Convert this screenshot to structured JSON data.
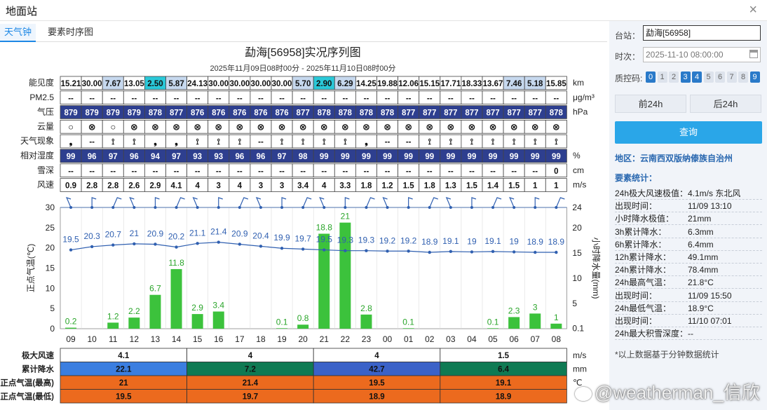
{
  "window": {
    "title": "地面站"
  },
  "tabs": [
    "天气钟",
    "要素时序图"
  ],
  "chart_data": {
    "type": "meteogram",
    "title": "勐海[56958]实况序列图",
    "subtitle": "2025年11月09日08时00分 - 2025年11月10日08时00分",
    "hours": [
      "09",
      "10",
      "11",
      "12",
      "13",
      "14",
      "15",
      "16",
      "17",
      "18",
      "19",
      "20",
      "21",
      "22",
      "23",
      "00",
      "01",
      "02",
      "03",
      "04",
      "05",
      "06",
      "07",
      "08"
    ],
    "rows": [
      {
        "label": "能见度",
        "unit": "km",
        "values": [
          "15.21",
          "30.00",
          "7.67",
          "13.05",
          "2.50",
          "5.87",
          "24.13",
          "30.00",
          "30.00",
          "30.00",
          "30.00",
          "5.70",
          "2.90",
          "6.29",
          "14.25",
          "19.88",
          "12.06",
          "15.15",
          "17.71",
          "18.33",
          "13.67",
          "7.46",
          "5.18",
          "15.85"
        ]
      },
      {
        "label": "PM2.5",
        "unit": "μg/m³",
        "values": [
          "--",
          "--",
          "--",
          "--",
          "--",
          "--",
          "--",
          "--",
          "--",
          "--",
          "--",
          "--",
          "--",
          "--",
          "--",
          "--",
          "--",
          "--",
          "--",
          "--",
          "--",
          "--",
          "--",
          "--"
        ]
      },
      {
        "label": "气压",
        "unit": "hPa",
        "values": [
          "879",
          "879",
          "879",
          "879",
          "878",
          "877",
          "876",
          "876",
          "876",
          "876",
          "876",
          "877",
          "878",
          "878",
          "878",
          "878",
          "877",
          "877",
          "877",
          "877",
          "877",
          "877",
          "877",
          "878"
        ]
      },
      {
        "label": "云量",
        "unit": "",
        "values": [
          "○",
          "⊗",
          "○",
          "⊗",
          "⊗",
          "⊗",
          "⊗",
          "⊗",
          "⊗",
          "⊗",
          "⊗",
          "⊗",
          "⊗",
          "⊗",
          "⊗",
          "⊗",
          "⊗",
          "⊗",
          "⊗",
          "⊗",
          "⊗",
          "⊗",
          "⊗",
          "⊗"
        ]
      },
      {
        "label": "天气现象",
        "unit": "",
        "values": [
          "❟",
          "--",
          "⟟",
          "⟟",
          "❟",
          "❟",
          "⟟",
          "⟟",
          "⟟",
          "--",
          "⟟",
          "⟟",
          "⟟",
          "⟟",
          "❟",
          "--",
          "--",
          "⟟",
          "⟟",
          "⟟",
          "⟟",
          "⟟",
          "⟟",
          "⟟"
        ]
      },
      {
        "label": "相对湿度",
        "unit": "%",
        "values": [
          "99",
          "96",
          "97",
          "96",
          "94",
          "97",
          "93",
          "93",
          "96",
          "96",
          "97",
          "98",
          "99",
          "99",
          "99",
          "99",
          "99",
          "99",
          "99",
          "99",
          "99",
          "99",
          "99",
          "99"
        ]
      },
      {
        "label": "雪深",
        "unit": "cm",
        "values": [
          "--",
          "--",
          "--",
          "--",
          "--",
          "--",
          "--",
          "--",
          "--",
          "--",
          "--",
          "--",
          "--",
          "--",
          "--",
          "--",
          "--",
          "--",
          "--",
          "--",
          "--",
          "--",
          "--",
          "0"
        ]
      },
      {
        "label": "风速",
        "unit": "m/s",
        "values": [
          "0.9",
          "2.8",
          "2.8",
          "2.6",
          "2.9",
          "4.1",
          "4",
          "3",
          "4",
          "3",
          "3",
          "3.4",
          "4",
          "3.3",
          "1.8",
          "1.2",
          "1.5",
          "1.8",
          "1.3",
          "1.5",
          "1.4",
          "1.5",
          "1",
          "1"
        ]
      }
    ],
    "temperature": [
      19.5,
      20.3,
      20.7,
      21,
      20.9,
      20.2,
      21.1,
      21.4,
      20.9,
      20.4,
      19.9,
      19.7,
      19.5,
      19.3,
      19.3,
      19.2,
      19.2,
      18.9,
      19.1,
      19,
      19.1,
      19,
      18.9,
      18.9
    ],
    "precipitation": [
      0.2,
      0,
      1.2,
      2.2,
      6.7,
      11.8,
      2.9,
      3.4,
      0,
      0,
      0.1,
      0.8,
      18.8,
      21,
      2.8,
      0,
      0.1,
      0,
      0,
      0,
      0.1,
      2.3,
      3,
      1
    ],
    "y_left": {
      "label": "正点气温(℃)",
      "ylim": [
        0,
        30
      ],
      "ticks": [
        "0",
        "5",
        "10",
        "15",
        "20",
        "25",
        "30"
      ]
    },
    "y_right": {
      "label": "小时降水量(mm)",
      "ylim": [
        0,
        24
      ],
      "ticks": [
        "0.1",
        "5",
        "10",
        "15",
        "20",
        "24"
      ]
    },
    "summary": [
      {
        "label": "极大风速",
        "unit": "m/s",
        "values": [
          "4.1",
          "4",
          "4",
          "1.5"
        ]
      },
      {
        "label": "累计降水",
        "unit": "mm",
        "values": [
          "22.1",
          "7.2",
          "42.7",
          "6.4"
        ]
      },
      {
        "label": "正点气温(最高)",
        "unit": "℃",
        "values": [
          "21",
          "21.4",
          "19.5",
          "19.1"
        ]
      },
      {
        "label": "正点气温(最低)",
        "unit": "",
        "values": [
          "19.5",
          "19.7",
          "18.9",
          "18.9"
        ]
      }
    ]
  },
  "sidebar": {
    "station_label": "台站：",
    "station_value": "勐海[56958]",
    "time_label": "时次：",
    "time_value": "2025-11-10 08:00:00",
    "qc_label": "质控码:",
    "qc_codes": [
      "0",
      "1",
      "2",
      "3",
      "4",
      "5",
      "6",
      "7",
      "8",
      "9"
    ],
    "prev_button": "前24h",
    "next_button": "后24h",
    "query_button": "查询",
    "region": "地区：云南西双版纳傣族自治州",
    "stats_title": "要素统计：",
    "stats": [
      {
        "label": "24h极大风速极值：",
        "value": "4.1m/s 东北风"
      },
      {
        "label": "出现时间：",
        "value": "11/09 13:10"
      },
      {
        "label": "小时降水极值：",
        "value": "21mm"
      },
      {
        "label": "3h累计降水：",
        "value": "6.3mm"
      },
      {
        "label": "6h累计降水：",
        "value": "6.4mm"
      },
      {
        "label": "12h累计降水：",
        "value": "49.1mm"
      },
      {
        "label": "24h累计降水：",
        "value": "78.4mm"
      },
      {
        "label": "24h最高气温：",
        "value": "21.8°C"
      },
      {
        "label": "出现时间：",
        "value": "11/09 15:50"
      },
      {
        "label": "24h最低气温：",
        "value": "18.9°C"
      },
      {
        "label": "出现时间：",
        "value": "11/10 07:01"
      },
      {
        "label": "24h最大积雪深度：--",
        "value": ""
      }
    ],
    "footnote": "*以上数据基于分钟数据统计"
  },
  "watermark": "@weatherman_信欣",
  "colors": {
    "accent": "#1e88e5",
    "temp_line": "#2f5fb0",
    "bar_green": "#3cc23c",
    "pressure_bg": "#2e3f8f",
    "humidity_bg": "#2e3f8f"
  }
}
